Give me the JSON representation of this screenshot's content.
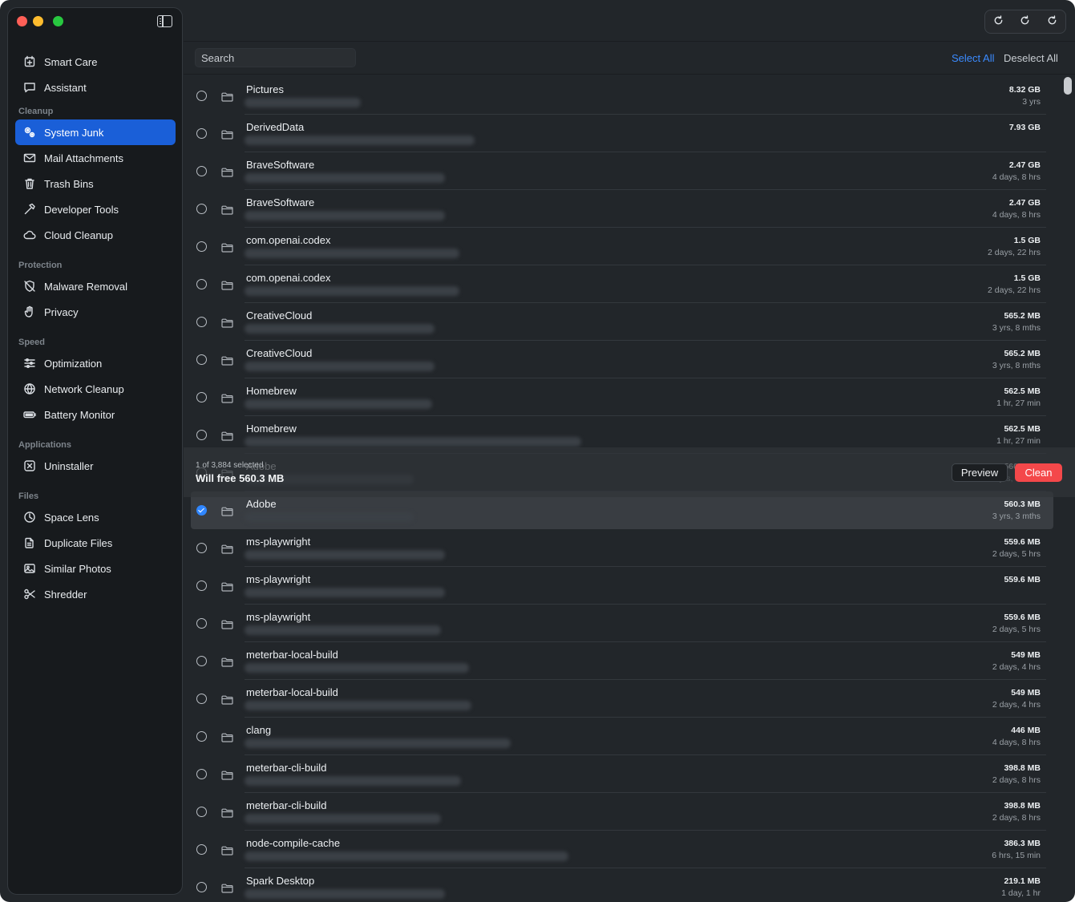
{
  "sidebar": {
    "items": [
      {
        "label": "Smart Care",
        "icon": "smart-care-icon",
        "active": false
      },
      {
        "label": "Assistant",
        "icon": "chat-bubble-icon",
        "active": false
      },
      {
        "label": "System Junk",
        "icon": "gears-icon",
        "active": true
      },
      {
        "label": "Mail Attachments",
        "icon": "envelope-icon",
        "active": false
      },
      {
        "label": "Trash Bins",
        "icon": "trash-icon",
        "active": false
      },
      {
        "label": "Developer Tools",
        "icon": "hammer-icon",
        "active": false
      },
      {
        "label": "Cloud Cleanup",
        "icon": "cloud-icon",
        "active": false
      },
      {
        "label": "Malware Removal",
        "icon": "shield-slash-icon",
        "active": false
      },
      {
        "label": "Privacy",
        "icon": "hand-icon",
        "active": false
      },
      {
        "label": "Optimization",
        "icon": "sliders-icon",
        "active": false
      },
      {
        "label": "Network Cleanup",
        "icon": "globe-icon",
        "active": false
      },
      {
        "label": "Battery Monitor",
        "icon": "battery-icon",
        "active": false
      },
      {
        "label": "Uninstaller",
        "icon": "xmark-box-icon",
        "active": false
      },
      {
        "label": "Space Lens",
        "icon": "clock-pie-icon",
        "active": false
      },
      {
        "label": "Duplicate Files",
        "icon": "files-icon",
        "active": false
      },
      {
        "label": "Similar Photos",
        "icon": "photos-icon",
        "active": false
      },
      {
        "label": "Shredder",
        "icon": "scissors-icon",
        "active": false
      }
    ],
    "sections": [
      "Cleanup",
      "Protection",
      "Speed",
      "Applications",
      "Files"
    ]
  },
  "toolbar": {
    "search_placeholder": "Search",
    "select_all": "Select All",
    "deselect_all": "Deselect All",
    "accent_color": "#3b8bff"
  },
  "rows": [
    {
      "name": "Pictures",
      "size": "8.32 GB",
      "age": "3 yrs",
      "checked": false
    },
    {
      "name": "DerivedData",
      "size": "7.93 GB",
      "age": "",
      "checked": false
    },
    {
      "name": "BraveSoftware",
      "size": "2.47 GB",
      "age": "4 days, 8 hrs",
      "checked": false
    },
    {
      "name": "BraveSoftware",
      "size": "2.47 GB",
      "age": "4 days, 8 hrs",
      "checked": false
    },
    {
      "name": "com.openai.codex",
      "size": "1.5 GB",
      "age": "2 days, 22 hrs",
      "checked": false
    },
    {
      "name": "com.openai.codex",
      "size": "1.5 GB",
      "age": "2 days, 22 hrs",
      "checked": false
    },
    {
      "name": "CreativeCloud",
      "size": "565.2 MB",
      "age": "3 yrs, 8 mths",
      "checked": false
    },
    {
      "name": "CreativeCloud",
      "size": "565.2 MB",
      "age": "3 yrs, 8 mths",
      "checked": false
    },
    {
      "name": "Homebrew",
      "size": "562.5 MB",
      "age": "1 hr, 27 min",
      "checked": false
    },
    {
      "name": "Homebrew",
      "size": "562.5 MB",
      "age": "1 hr, 27 min",
      "checked": false
    },
    {
      "name": "Adobe",
      "size": "560.3 MB",
      "age": "3 yrs, 3 mths",
      "checked": false
    },
    {
      "name": "Adobe",
      "size": "560.3 MB",
      "age": "3 yrs, 3 mths",
      "checked": true
    },
    {
      "name": "ms-playwright",
      "size": "559.6 MB",
      "age": "2 days, 5 hrs",
      "checked": false
    },
    {
      "name": "ms-playwright",
      "size": "559.6 MB",
      "age": "",
      "checked": false
    },
    {
      "name": "ms-playwright",
      "size": "559.6 MB",
      "age": "2 days, 5 hrs",
      "checked": false
    },
    {
      "name": "meterbar-local-build",
      "size": "549 MB",
      "age": "2 days, 4 hrs",
      "checked": false
    },
    {
      "name": "meterbar-local-build",
      "size": "549 MB",
      "age": "2 days, 4 hrs",
      "checked": false
    },
    {
      "name": "clang",
      "size": "446 MB",
      "age": "4 days, 8 hrs",
      "checked": false
    },
    {
      "name": "meterbar-cli-build",
      "size": "398.8 MB",
      "age": "2 days, 8 hrs",
      "checked": false
    },
    {
      "name": "meterbar-cli-build",
      "size": "398.8 MB",
      "age": "2 days, 8 hrs",
      "checked": false
    },
    {
      "name": "node-compile-cache",
      "size": "386.3 MB",
      "age": "6 hrs, 15 min",
      "checked": false
    },
    {
      "name": "Spark Desktop",
      "size": "219.1 MB",
      "age": "1 day, 1 hr",
      "checked": false
    }
  ],
  "status": {
    "selected_count": "1 of 3,884 selected",
    "will_free": "Will free 560.3 MB",
    "preview": "Preview",
    "clean": "Clean",
    "clean_color": "#f4484a"
  }
}
